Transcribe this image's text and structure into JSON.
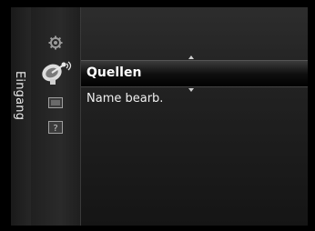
{
  "sidebar": {
    "title": "Eingang"
  },
  "menu": {
    "selected_label": "Quellen",
    "items": [
      {
        "label": "Name bearb."
      }
    ]
  },
  "icons": {
    "settings": "gear-icon",
    "input": "satellite-dish-icon",
    "support": "screen-icon",
    "help": "help-icon"
  }
}
